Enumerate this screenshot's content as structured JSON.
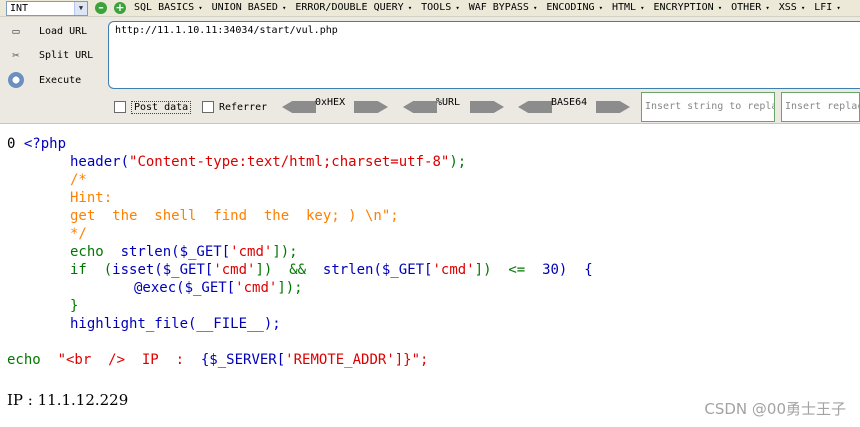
{
  "hackbar": {
    "int_select": "INT",
    "menu": [
      "SQL BASICS",
      "UNION BASED",
      "ERROR/DOUBLE QUERY",
      "TOOLS",
      "WAF BYPASS",
      "ENCODING",
      "HTML",
      "ENCRYPTION",
      "OTHER",
      "XSS",
      "LFI"
    ],
    "buttons": {
      "load": "Load URL",
      "split": "Split URL",
      "execute": "Execute"
    },
    "url": "http://11.1.10.11:34034/start/vul.php",
    "post_label": "Post data",
    "referrer_label": "Referrer",
    "encoders": [
      "0xHEX",
      "%URL",
      "BASE64"
    ],
    "replace_placeholder_1": "Insert string to replace",
    "replace_placeholder_2": "Insert replacing string"
  },
  "output": {
    "prefix": "0 ",
    "open_tag": "<?php",
    "l1_fn": "header(",
    "l1_str": "\"Content-type:text/html;charset=utf-8\"",
    "l1_end": ");",
    "l2": "/*",
    "l3": "Hint:",
    "l4": "get  the  shell  find  the  key; ) \\n\";",
    "l5": "*/",
    "l6_kw": "echo  ",
    "l6_fn": "strlen($_GET[",
    "l6_str": "'cmd'",
    "l6_end": "]);",
    "l7_kw": "if  (",
    "l7_a": "isset($_GET[",
    "l7_s1": "'cmd'",
    "l7_b": "])  ",
    "l7_op": "&&",
    "l7_c": "  strlen($_GET[",
    "l7_s2": "'cmd'",
    "l7_d": "])  ",
    "l7_op2": "<=",
    "l7_e": "  30)  {",
    "l8_a": "@exec($_GET[",
    "l8_s": "'cmd'",
    "l8_b": "]);",
    "l9": "}",
    "l10": "highlight_file(__FILE__);",
    "l11_kw": "echo  ",
    "l11_str": "\"<br  />  IP  :  ",
    "l11_var": "{$_SERVER[",
    "l11_s": "'REMOTE_ADDR'",
    "l11_end": "]}\";",
    "ip_text": "IP : 11.1.12.229"
  },
  "watermark": "CSDN @00勇士王子"
}
